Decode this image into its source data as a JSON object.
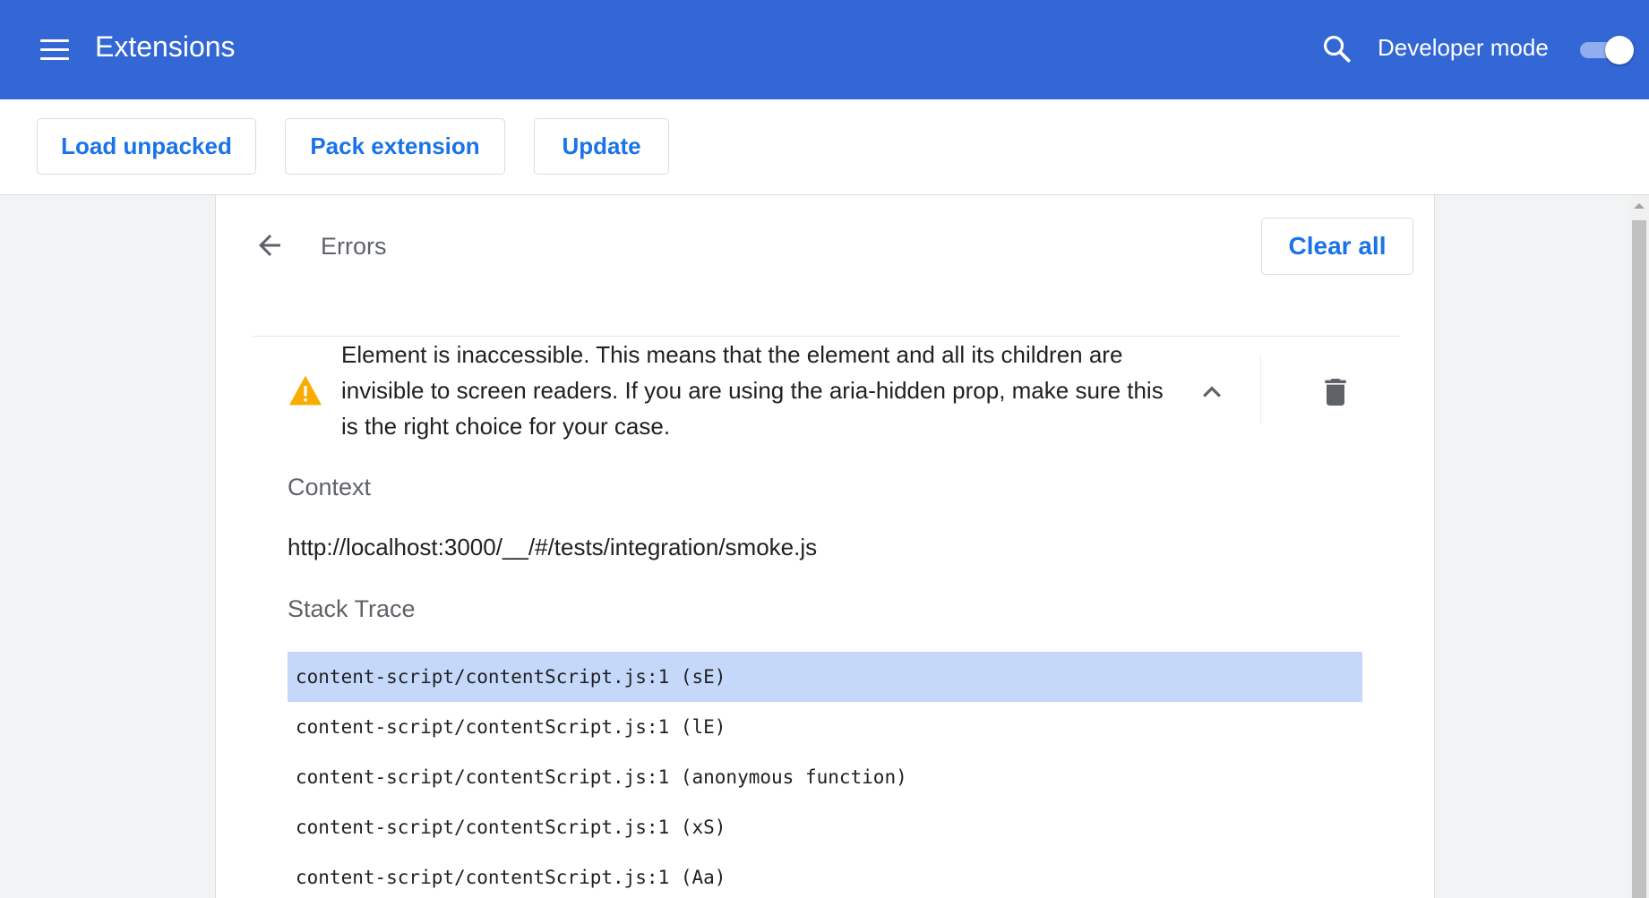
{
  "header": {
    "title": "Extensions",
    "developer_mode_label": "Developer mode",
    "developer_mode_on": true,
    "brand_color": "#3367d6"
  },
  "toolbar": {
    "load_unpacked": "Load unpacked",
    "pack_extension": "Pack extension",
    "update": "Update"
  },
  "errors_page": {
    "title": "Errors",
    "clear_all": "Clear all",
    "error": {
      "severity_icon": "warning-icon",
      "message": "Element is inaccessible. This means that the element and all its children are invisible to screen readers. If you are using the aria-hidden prop, make sure this is the right choice for your case."
    },
    "context_heading": "Context",
    "context_url": "http://localhost:3000/__/#/tests/integration/smoke.js",
    "stack_trace_heading": "Stack Trace",
    "stack_trace": [
      "content-script/contentScript.js:1 (sE)",
      "content-script/contentScript.js:1 (lE)",
      "content-script/contentScript.js:1 (anonymous function)",
      "content-script/contentScript.js:1 (xS)",
      "content-script/contentScript.js:1 (Aa)"
    ],
    "selected_stack_index": 0
  }
}
